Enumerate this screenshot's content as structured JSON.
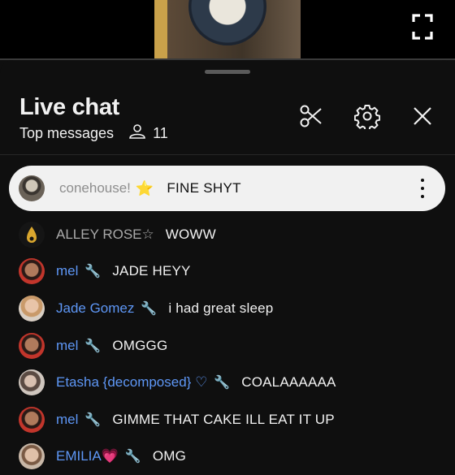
{
  "header": {
    "title": "Live chat",
    "filter_label": "Top messages",
    "viewer_count": "11",
    "icons": [
      "fullscreen-icon",
      "scissors-icon",
      "gear-icon",
      "close-icon"
    ]
  },
  "pinned": {
    "author": "conehouse!",
    "badge": "⭐",
    "message": "FINE SHYT"
  },
  "messages": [
    {
      "author": "ALLEY ROSE☆",
      "badge": "",
      "text": "WOWW"
    },
    {
      "author": "mel",
      "badge": "🔧",
      "text": "JADE HEYY"
    },
    {
      "author": "Jade Gomez",
      "badge": "🔧",
      "text": "i had great sleep"
    },
    {
      "author": "mel",
      "badge": "🔧",
      "text": "OMGGG"
    },
    {
      "author": "Etasha {decomposed} ♡",
      "badge": "🔧",
      "text": "COALAAAAAA"
    },
    {
      "author": "mel",
      "badge": "🔧",
      "text": "GIMME THAT CAKE ILL EAT IT UP"
    },
    {
      "author": "EMILIA💗",
      "badge": "🔧",
      "text": "OMG"
    }
  ],
  "colors": {
    "background": "#0f0f0f",
    "moderator_name": "#5e97f6",
    "plain_name": "#aaaaaa",
    "pinned_bg": "#f1f1f1"
  }
}
